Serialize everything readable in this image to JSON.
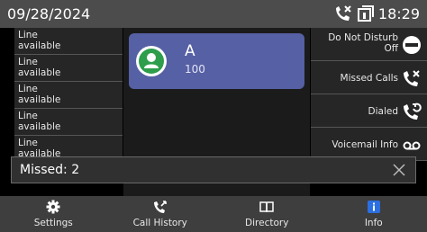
{
  "status_bar": {
    "date": "09/28/2024",
    "time": "18:29",
    "icons": [
      "missed-call-icon",
      "screen-icon"
    ]
  },
  "line_keys": [
    {
      "line1": "Line",
      "line2": "available"
    },
    {
      "line1": "Line",
      "line2": "available"
    },
    {
      "line1": "Line",
      "line2": "available"
    },
    {
      "line1": "Line",
      "line2": "available"
    },
    {
      "line1": "Line",
      "line2": "available"
    }
  ],
  "account": {
    "name": "A",
    "number": "100",
    "color": "#5660a4",
    "avatar_color": "#2e9d4c"
  },
  "right_keys": [
    {
      "line1": "Do Not Disturb",
      "line2": "Off",
      "icon": "do-not-disturb-icon"
    },
    {
      "line1": "Missed Calls",
      "icon": "missed-calls-icon"
    },
    {
      "line1": "Dialed",
      "icon": "dialed-icon"
    },
    {
      "line1": "Voicemail Info",
      "icon": "voicemail-icon"
    }
  ],
  "notification": {
    "text": "Missed: 2"
  },
  "softkeys": [
    {
      "label": "Settings",
      "icon": "gear-icon"
    },
    {
      "label": "Call History",
      "icon": "call-history-icon"
    },
    {
      "label": "Directory",
      "icon": "book-icon"
    },
    {
      "label": "Info",
      "icon": "info-icon",
      "accent": "#2b6fe0"
    }
  ]
}
